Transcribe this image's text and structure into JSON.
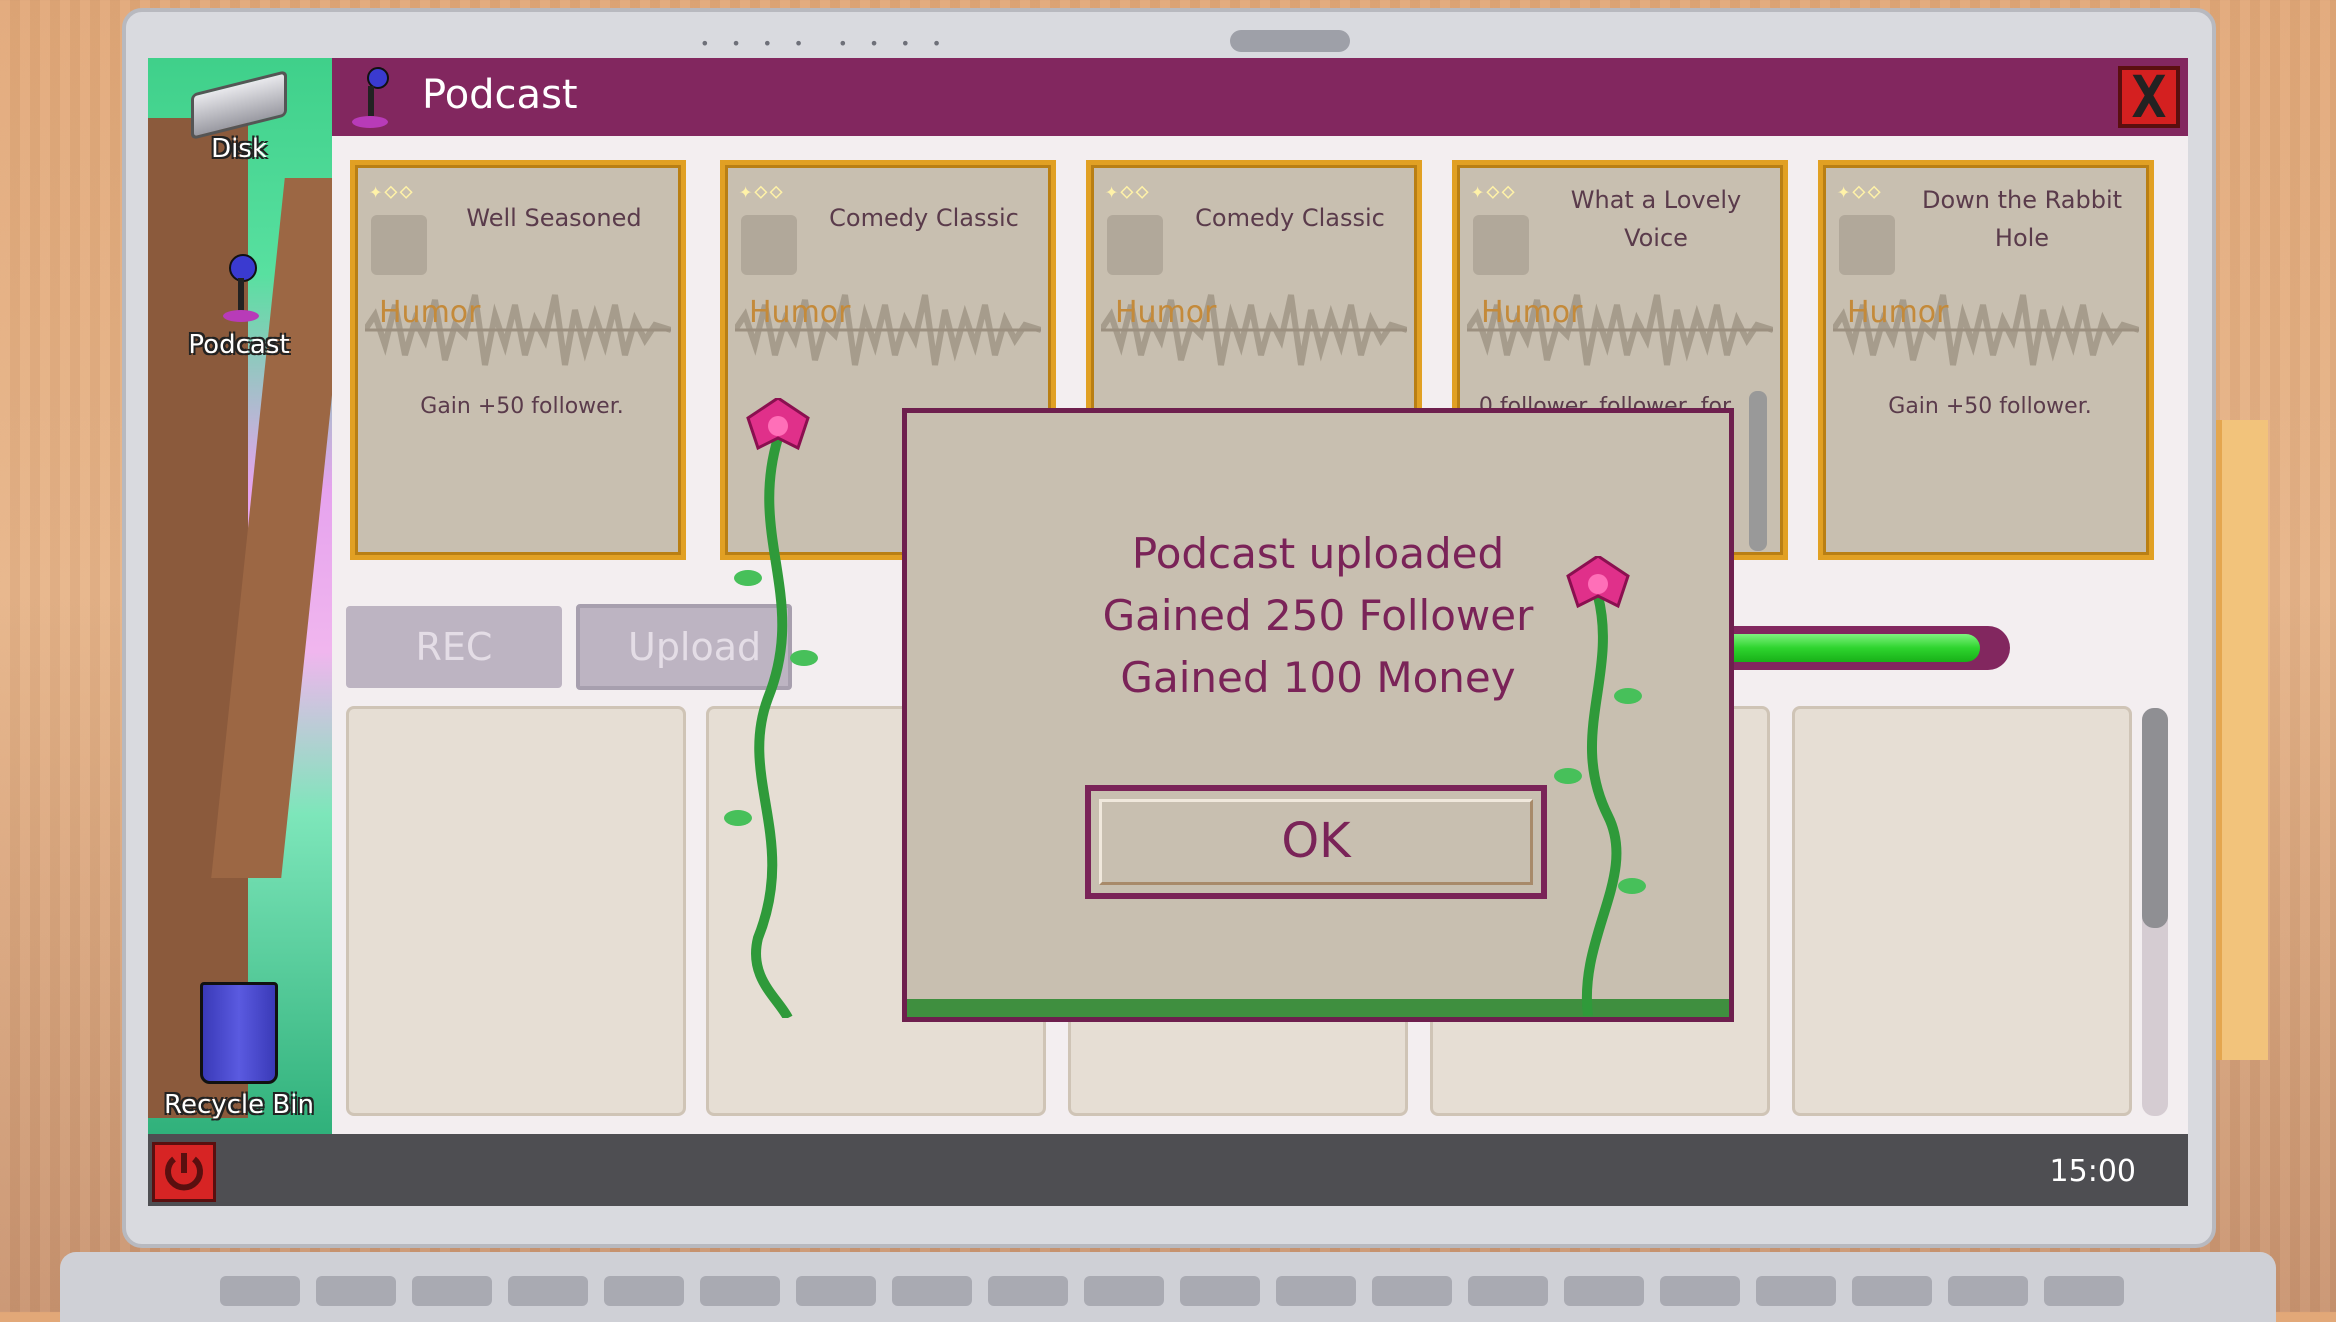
{
  "desktop": {
    "icons": [
      {
        "label": "Disk"
      },
      {
        "label": "Podcast"
      },
      {
        "label": "Recycle Bin"
      }
    ]
  },
  "window": {
    "title": "Podcast",
    "close_label": "X"
  },
  "cards": [
    {
      "title": "Well Seasoned",
      "category": "Humor",
      "description": "Gain +50 follower."
    },
    {
      "title": "Comedy Classic",
      "category": "Humor",
      "description": ""
    },
    {
      "title": "Comedy Classic",
      "category": "Humor",
      "description": ""
    },
    {
      "title": "What a Lovely Voice",
      "category": "Humor",
      "description": "0 follower. follower, for Grief, Info, , Sponsor"
    },
    {
      "title": "Down the Rabbit Hole",
      "category": "Humor",
      "description": "Gain +50 follower."
    }
  ],
  "controls": {
    "rec_label": "REC",
    "upload_label": "Upload",
    "progress_fraction": 0.96
  },
  "modal": {
    "line1": "Podcast uploaded",
    "line2": "Gained 250 Follower",
    "line3": "Gained 100 Money",
    "ok_label": "OK"
  },
  "taskbar": {
    "clock": "15:00"
  },
  "colors": {
    "title_bar": "#82275f",
    "card_border": "#e1a023",
    "progress": "#2ed42e",
    "modal_text": "#7a2358"
  }
}
